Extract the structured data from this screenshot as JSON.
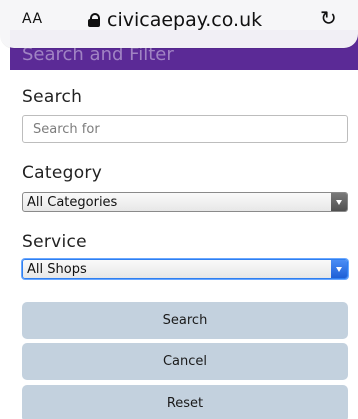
{
  "browser": {
    "text_size_label": "AA",
    "url": "civicaepay.co.uk",
    "reload_glyph": "↻",
    "lock_icon": "lock-icon"
  },
  "panel": {
    "heading": "Search and Filter",
    "band_color": "#5b2a96"
  },
  "search": {
    "label": "Search",
    "placeholder": "Search for",
    "value": ""
  },
  "category": {
    "label": "Category",
    "selected": "All Categories"
  },
  "service": {
    "label": "Service",
    "selected": "All Shops"
  },
  "buttons": {
    "search_label": "Search",
    "cancel_label": "Cancel",
    "reset_label": "Reset",
    "color": "#c3d1de"
  }
}
